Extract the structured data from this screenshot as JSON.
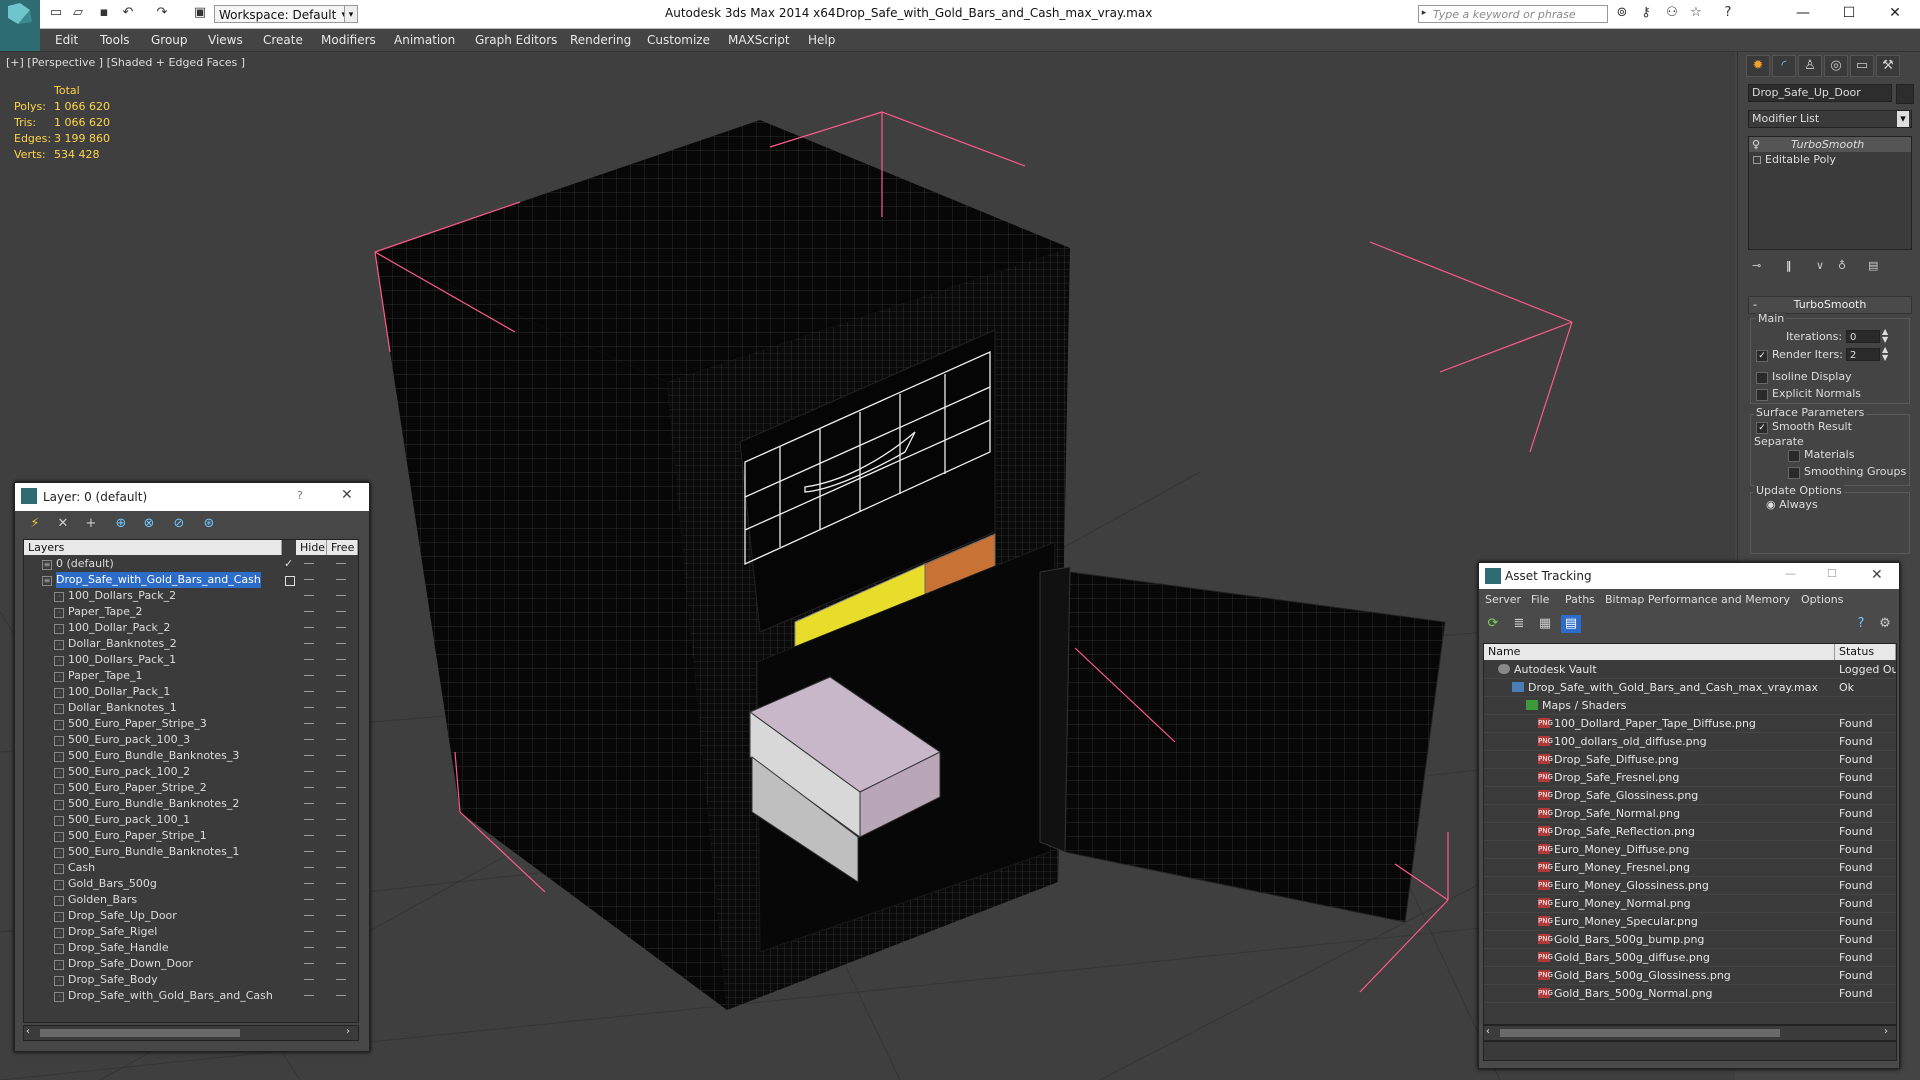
{
  "app": {
    "title": "Autodesk 3ds Max  2014 x64",
    "file": "Drop_Safe_with_Gold_Bars_and_Cash_max_vray.max",
    "workspace": "Workspace: Default",
    "search_placeholder": "Type a keyword or phrase",
    "accent": "#2e6b73"
  },
  "menu": [
    "Edit",
    "Tools",
    "Group",
    "Views",
    "Create",
    "Modifiers",
    "Animation",
    "Graph Editors",
    "Rendering",
    "Customize",
    "MAXScript",
    "Help"
  ],
  "viewport": {
    "label": "[+] [Perspective ] [Shaded + Edged Faces ]",
    "stats": {
      "header": "Total",
      "rows": [
        {
          "k": "Polys:",
          "v": "1 066 620"
        },
        {
          "k": "Tris:",
          "v": "1 066 620"
        },
        {
          "k": "Edges:",
          "v": "3 199 860"
        },
        {
          "k": "Verts:",
          "v": "534 428"
        }
      ]
    }
  },
  "command_panel": {
    "object_name": "Drop_Safe_Up_Door",
    "modifier_list": "Modifier List",
    "stack": [
      "TurboSmooth",
      "Editable Poly"
    ],
    "rollout": "TurboSmooth",
    "main": "Main",
    "iterations_label": "Iterations:",
    "iterations": "0",
    "render_iters_label": "Render Iters:",
    "render_iters": "2",
    "isoline": "Isoline Display",
    "explicit_normals": "Explicit Normals",
    "surface_params": "Surface Parameters",
    "smooth_result": "Smooth Result",
    "separate": "Separate",
    "materials": "Materials",
    "smoothing_groups": "Smoothing Groups",
    "update_options": "Update Options",
    "always": "Always"
  },
  "layer_dialog": {
    "title": "Layer: 0 (default)",
    "help": "?",
    "col_layers": "Layers",
    "col_hide": "Hide",
    "col_freeze": "Free",
    "rows": [
      "0 (default)",
      "Drop_Safe_with_Gold_Bars_and_Cash",
      "100_Dollars_Pack_2",
      "Paper_Tape_2",
      "100_Dollar_Pack_2",
      "Dollar_Banknotes_2",
      "100_Dollars_Pack_1",
      "Paper_Tape_1",
      "100_Dollar_Pack_1",
      "Dollar_Banknotes_1",
      "500_Euro_Paper_Stripe_3",
      "500_Euro_pack_100_3",
      "500_Euro_Bundle_Banknotes_3",
      "500_Euro_pack_100_2",
      "500_Euro_Paper_Stripe_2",
      "500_Euro_Bundle_Banknotes_2",
      "500_Euro_pack_100_1",
      "500_Euro_Paper_Stripe_1",
      "500_Euro_Bundle_Banknotes_1",
      "Cash",
      "Gold_Bars_500g",
      "Golden_Bars",
      "Drop_Safe_Up_Door",
      "Drop_Safe_Rigel",
      "Drop_Safe_Handle",
      "Drop_Safe_Down_Door",
      "Drop_Safe_Body",
      "Drop_Safe_with_Gold_Bars_and_Cash"
    ]
  },
  "asset_dialog": {
    "title": "Asset Tracking",
    "menu": [
      "Server",
      "File",
      "Paths",
      "Bitmap Performance and Memory",
      "Options"
    ],
    "col_name": "Name",
    "col_status": "Status",
    "rows": [
      {
        "name": "Autodesk Vault",
        "status": "Logged Ou",
        "level": 0
      },
      {
        "name": "Drop_Safe_with_Gold_Bars_and_Cash_max_vray.max",
        "status": "Ok",
        "level": 1
      },
      {
        "name": "Maps / Shaders",
        "status": "",
        "level": 2
      },
      {
        "name": "100_Dollard_Paper_Tape_Diffuse.png",
        "status": "Found",
        "level": 3
      },
      {
        "name": "100_dollars_old_diffuse.png",
        "status": "Found",
        "level": 3
      },
      {
        "name": "Drop_Safe_Diffuse.png",
        "status": "Found",
        "level": 3
      },
      {
        "name": "Drop_Safe_Fresnel.png",
        "status": "Found",
        "level": 3
      },
      {
        "name": "Drop_Safe_Glossiness.png",
        "status": "Found",
        "level": 3
      },
      {
        "name": "Drop_Safe_Normal.png",
        "status": "Found",
        "level": 3
      },
      {
        "name": "Drop_Safe_Reflection.png",
        "status": "Found",
        "level": 3
      },
      {
        "name": "Euro_Money_Diffuse.png",
        "status": "Found",
        "level": 3
      },
      {
        "name": "Euro_Money_Fresnel.png",
        "status": "Found",
        "level": 3
      },
      {
        "name": "Euro_Money_Glossiness.png",
        "status": "Found",
        "level": 3
      },
      {
        "name": "Euro_Money_Normal.png",
        "status": "Found",
        "level": 3
      },
      {
        "name": "Euro_Money_Specular.png",
        "status": "Found",
        "level": 3
      },
      {
        "name": "Gold_Bars_500g_bump.png",
        "status": "Found",
        "level": 3
      },
      {
        "name": "Gold_Bars_500g_diffuse.png",
        "status": "Found",
        "level": 3
      },
      {
        "name": "Gold_Bars_500g_Glossiness.png",
        "status": "Found",
        "level": 3
      },
      {
        "name": "Gold_Bars_500g_Normal.png",
        "status": "Found",
        "level": 3
      }
    ]
  }
}
